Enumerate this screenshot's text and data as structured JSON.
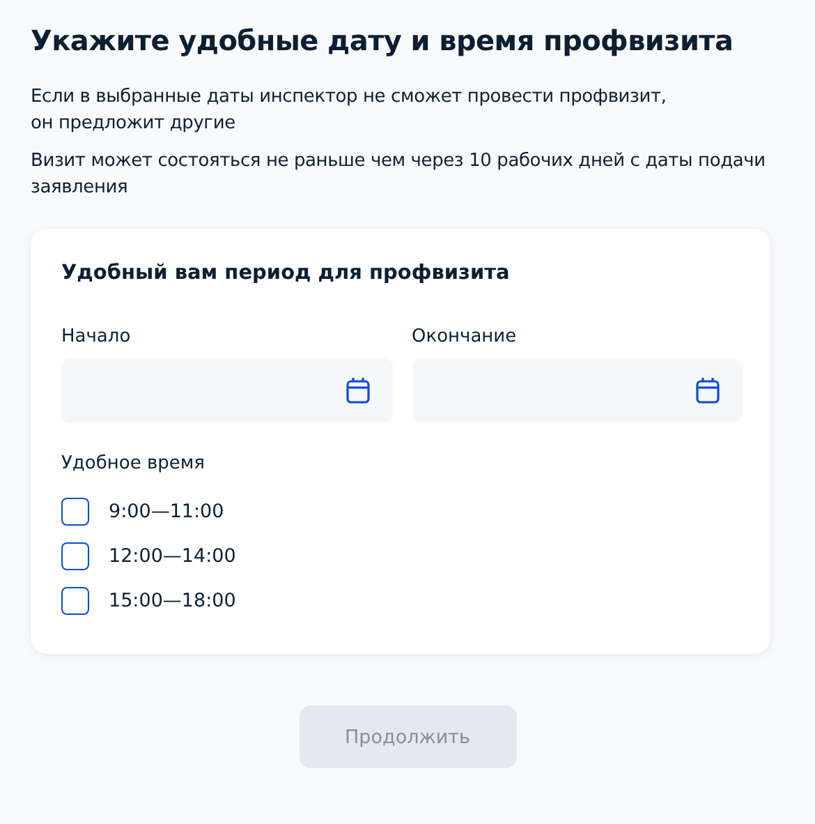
{
  "title": "Укажите удобные дату и время профвизита",
  "notes": [
    "Если в выбранные даты инспектор не сможет провести профвизит,\nон предложит другие",
    "Визит может состояться не раньше чем через 10 рабочих дней с даты подачи заявления"
  ],
  "card": {
    "title": "Удобный вам период для профвизита",
    "date_fields": [
      {
        "label": "Начало"
      },
      {
        "label": "Окончание"
      }
    ],
    "time_label": "Удобное время",
    "time_slots": [
      {
        "label": "9:00—11:00",
        "checked": false
      },
      {
        "label": "12:00—14:00",
        "checked": false
      },
      {
        "label": "15:00—18:00",
        "checked": false
      }
    ]
  },
  "continue_button": {
    "label": "Продолжить",
    "disabled": true
  }
}
